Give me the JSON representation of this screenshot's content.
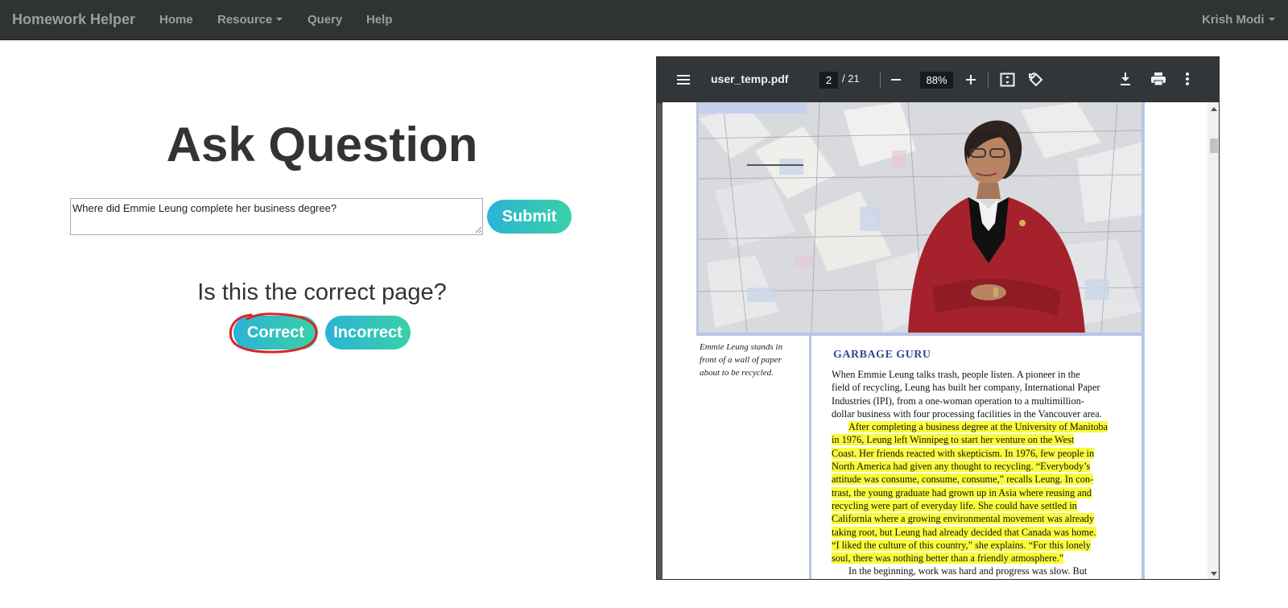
{
  "navbar": {
    "brand": "Homework Helper",
    "items": [
      {
        "label": "Home"
      },
      {
        "label": "Resource"
      },
      {
        "label": "Query"
      },
      {
        "label": "Help"
      }
    ],
    "user": "Krish Modi"
  },
  "main": {
    "title": "Ask Question",
    "question_value": "Where did Emmie Leung complete her business degree?",
    "submit_label": "Submit",
    "verify_prompt": "Is this the correct page?",
    "correct_label": "Correct",
    "incorrect_label": "Incorrect",
    "annotation_color": "#d9262c"
  },
  "pdf": {
    "filename": "user_temp.pdf",
    "current_page": "2",
    "total_pages": "/ 21",
    "zoom": "88%",
    "page": {
      "caption": [
        "Emmie Leung stands in",
        "front of a wall of paper",
        "about to be recycled."
      ],
      "article_title": "GARBAGE GURU",
      "para1": [
        "When Emmie Leung talks trash, people listen. A pioneer in the",
        "field of recycling, Leung has built her company, International Paper",
        "Industries (IPI), from a one-woman operation to a multimillion-",
        "dollar business with four processing facilities in the Vancouver area."
      ],
      "para2_highlighted": [
        "After completing a business degree at the University of Manitoba",
        "in 1976, Leung left Winnipeg to start her venture on the West",
        "Coast. Her friends reacted with skepticism. In 1976, few people in",
        "North America had given any thought to recycling. “Everybody’s",
        "attitude was consume, consume, consume,” recalls Leung. In con-",
        "trast, the young graduate had grown up in Asia where reusing and",
        "recycling were part of everyday life. She could have settled in",
        "California where a growing environmental movement was already",
        "taking root, but Leung had already decided that Canada was home.",
        "“I liked the culture of this country,” she explains. “For this lonely",
        "soul, there was nothing better than a friendly atmosphere.”"
      ],
      "para3_start": "In the beginning, work was hard and progress was slow. But"
    },
    "highlight_color": "#fafb3a"
  }
}
